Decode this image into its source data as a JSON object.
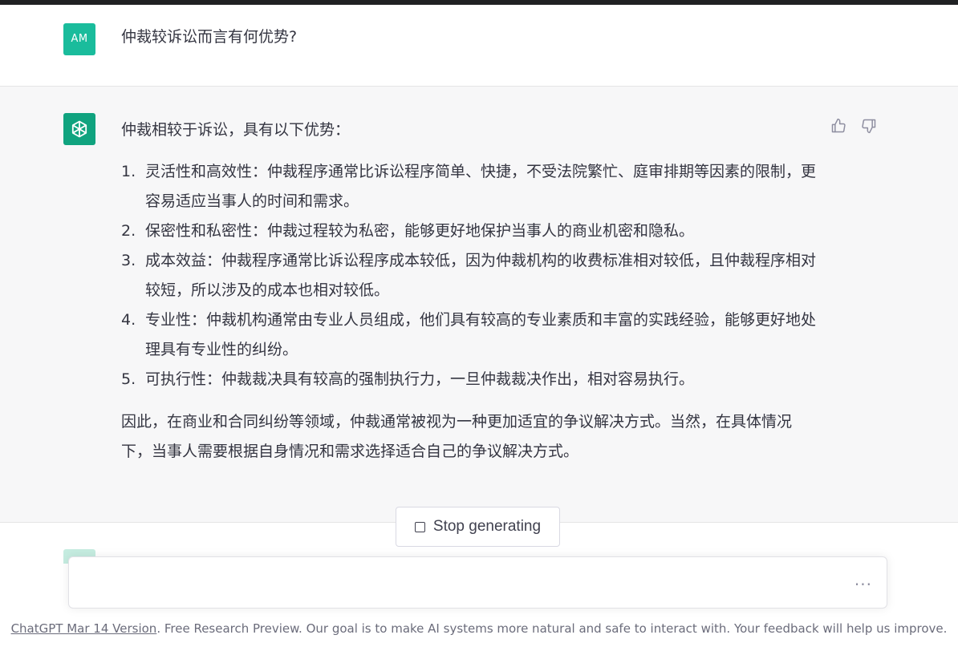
{
  "user_message": {
    "avatar_initials": "AM",
    "text": "仲裁较诉讼而言有何优势?"
  },
  "assistant_message": {
    "intro": "仲裁相较于诉讼，具有以下优势：",
    "points": [
      {
        "num": "1.",
        "text": "灵活性和高效性：仲裁程序通常比诉讼程序简单、快捷，不受法院繁忙、庭审排期等因素的限制，更容易适应当事人的时间和需求。"
      },
      {
        "num": "2.",
        "text": "保密性和私密性：仲裁过程较为私密，能够更好地保护当事人的商业机密和隐私。"
      },
      {
        "num": "3.",
        "text": "成本效益：仲裁程序通常比诉讼程序成本较低，因为仲裁机构的收费标准相对较低，且仲裁程序相对较短，所以涉及的成本也相对较低。"
      },
      {
        "num": "4.",
        "text": "专业性：仲裁机构通常由专业人员组成，他们具有较高的专业素质和丰富的实践经验，能够更好地处理具有专业性的纠纷。"
      },
      {
        "num": "5.",
        "text": "可执行性：仲裁裁决具有较高的强制执行力，一旦仲裁裁决作出，相对容易执行。"
      }
    ],
    "conclusion": "因此，在商业和合同纠纷等领域，仲裁通常被视为一种更加适宜的争议解决方式。当然，在具体情况下，当事人需要根据自身情况和需求选择适合自己的争议解决方式。"
  },
  "controls": {
    "stop_label": "Stop generating",
    "input_value": "",
    "more_label": "···"
  },
  "footer": {
    "link_text": "ChatGPT Mar 14 Version",
    "text": ". Free Research Preview. Our goal is to make AI systems more natural and safe to interact with. Your feedback will help us improve."
  },
  "colors": {
    "brand_green": "#10a37f",
    "user_avatar": "#1abc9c",
    "assistant_bg": "#f7f7f8"
  },
  "icons": [
    "openai-logo-icon",
    "thumbs-up-icon",
    "thumbs-down-icon",
    "stop-square-icon",
    "more-dots-icon"
  ]
}
